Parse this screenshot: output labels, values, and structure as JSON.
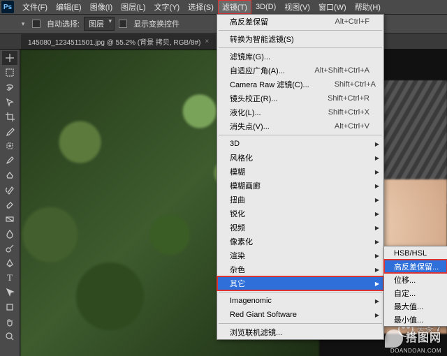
{
  "menubar": {
    "items": [
      "文件(F)",
      "编辑(E)",
      "图像(I)",
      "图层(L)",
      "文字(Y)",
      "选择(S)",
      "滤镜(T)",
      "3D(D)",
      "视图(V)",
      "窗口(W)",
      "帮助(H)"
    ],
    "open_index": 6
  },
  "optionsbar": {
    "auto_select_label": "自动选择:",
    "auto_select_mode": "图层",
    "show_transform_label": "显示变换控件"
  },
  "doc_tab": {
    "title": "145080_1234511501.jpg @ 55.2% (背景 拷贝, RGB/8#)"
  },
  "filter_menu": {
    "top": {
      "label": "高反差保留",
      "shortcut": "Alt+Ctrl+F"
    },
    "smart": {
      "label": "转换为智能滤镜(S)"
    },
    "group1": [
      {
        "label": "滤镜库(G)...",
        "shortcut": ""
      },
      {
        "label": "自适应广角(A)...",
        "shortcut": "Alt+Shift+Ctrl+A"
      },
      {
        "label": "Camera Raw 滤镜(C)...",
        "shortcut": "Shift+Ctrl+A"
      },
      {
        "label": "镜头校正(R)...",
        "shortcut": "Shift+Ctrl+R"
      },
      {
        "label": "液化(L)...",
        "shortcut": "Shift+Ctrl+X"
      },
      {
        "label": "消失点(V)...",
        "shortcut": "Alt+Ctrl+V"
      }
    ],
    "group2": [
      "3D",
      "风格化",
      "模糊",
      "模糊画廊",
      "扭曲",
      "锐化",
      "视频",
      "像素化",
      "渲染",
      "杂色",
      "其它"
    ],
    "group3": [
      "Imagenomic",
      "Red Giant Software"
    ],
    "bottom": {
      "label": "浏览联机滤镜..."
    },
    "highlighted": "其它"
  },
  "submenu_other": {
    "items": [
      "HSB/HSL",
      "高反差保留...",
      "位移...",
      "自定...",
      "最大值...",
      "最小值..."
    ],
    "highlighted_index": 1
  },
  "watermarks": {
    "wm_top": "头条",
    "wm_big": "搭图网",
    "wm_url": "DOANDOAN.COM"
  }
}
